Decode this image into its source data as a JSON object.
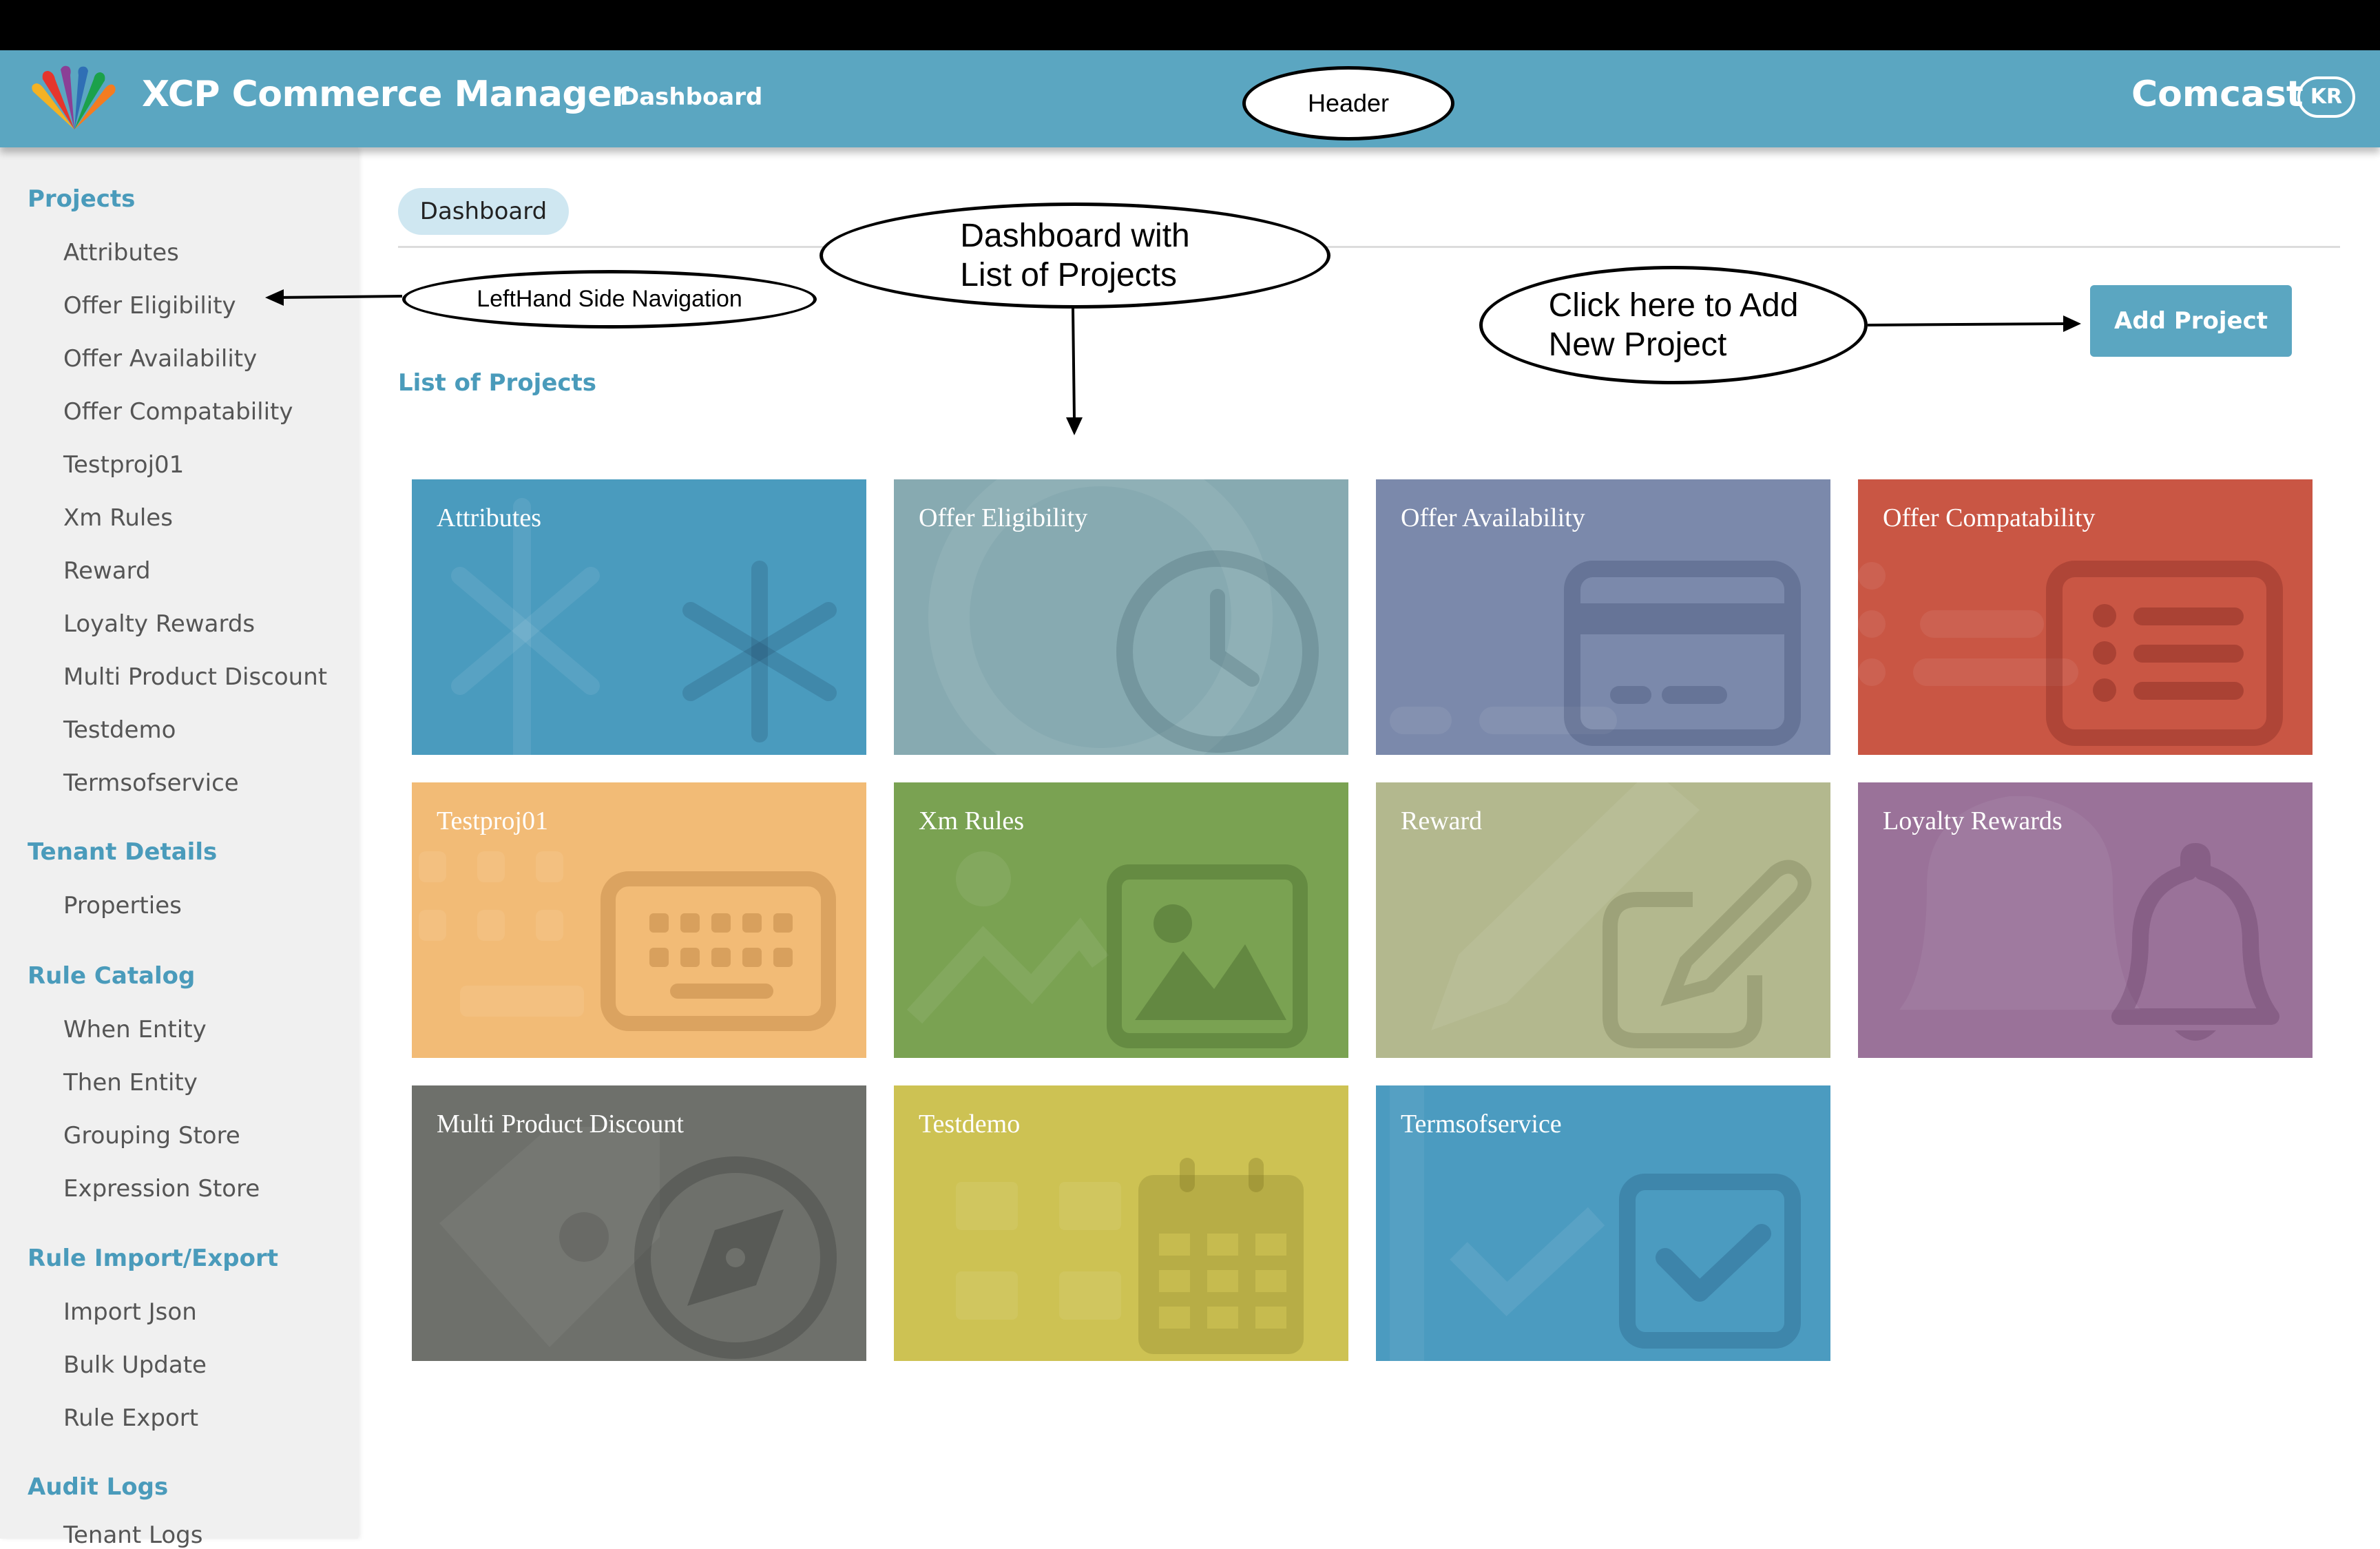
{
  "header": {
    "app_title": "XCP Commerce Manager",
    "nav_dashboard": "Dashboard",
    "tenant": "Comcast",
    "avatar_initials": "KR",
    "background": "#5ba6c1"
  },
  "sidebar": {
    "sections": [
      {
        "title": "Projects",
        "items": [
          "Attributes",
          "Offer Eligibility",
          "Offer Availability",
          "Offer Compatability",
          "Testproj01",
          "Xm Rules",
          "Reward",
          "Loyalty Rewards",
          "Multi Product Discount",
          "Testdemo",
          "Termsofservice"
        ]
      },
      {
        "title": "Tenant Details",
        "items": [
          "Properties"
        ]
      },
      {
        "title": "Rule Catalog",
        "items": [
          "When Entity",
          "Then Entity",
          "Grouping Store",
          "Expression Store"
        ]
      },
      {
        "title": "Rule Import/Export",
        "items": [
          "Import Json",
          "Bulk Update",
          "Rule Export"
        ]
      },
      {
        "title": "Audit Logs",
        "items": [
          "Tenant Logs"
        ]
      }
    ]
  },
  "main": {
    "breadcrumb": "Dashboard",
    "list_title": "List of Projects",
    "add_button": "Add Project",
    "tiles": [
      {
        "name": "Attributes",
        "color": "#4a9bbe",
        "icon": "asterisk-icon"
      },
      {
        "name": "Offer Eligibility",
        "color": "#87aab1",
        "icon": "clock-icon"
      },
      {
        "name": "Offer Availability",
        "color": "#7b89ab",
        "icon": "credit-card-icon"
      },
      {
        "name": "Offer Compatability",
        "color": "#c95644",
        "icon": "list-icon"
      },
      {
        "name": "Testproj01",
        "color": "#f2bb76",
        "icon": "keyboard-icon"
      },
      {
        "name": "Xm Rules",
        "color": "#7aa252",
        "icon": "image-icon"
      },
      {
        "name": "Reward",
        "color": "#b3b88e",
        "icon": "edit-icon"
      },
      {
        "name": "Loyalty Rewards",
        "color": "#9a7299",
        "icon": "bell-icon"
      },
      {
        "name": "Multi Product Discount",
        "color": "#6e706b",
        "icon": "compass-icon"
      },
      {
        "name": "Testdemo",
        "color": "#cdc253",
        "icon": "calendar-icon"
      },
      {
        "name": "Termsofservice",
        "color": "#4b9bc0",
        "icon": "checkbox-icon"
      }
    ]
  },
  "annotations": {
    "header": "Header",
    "left_nav": "LeftHand Side Navigation",
    "dashboard": "Dashboard with\nList of Projects",
    "add_project": "Click here to Add\nNew Project"
  }
}
